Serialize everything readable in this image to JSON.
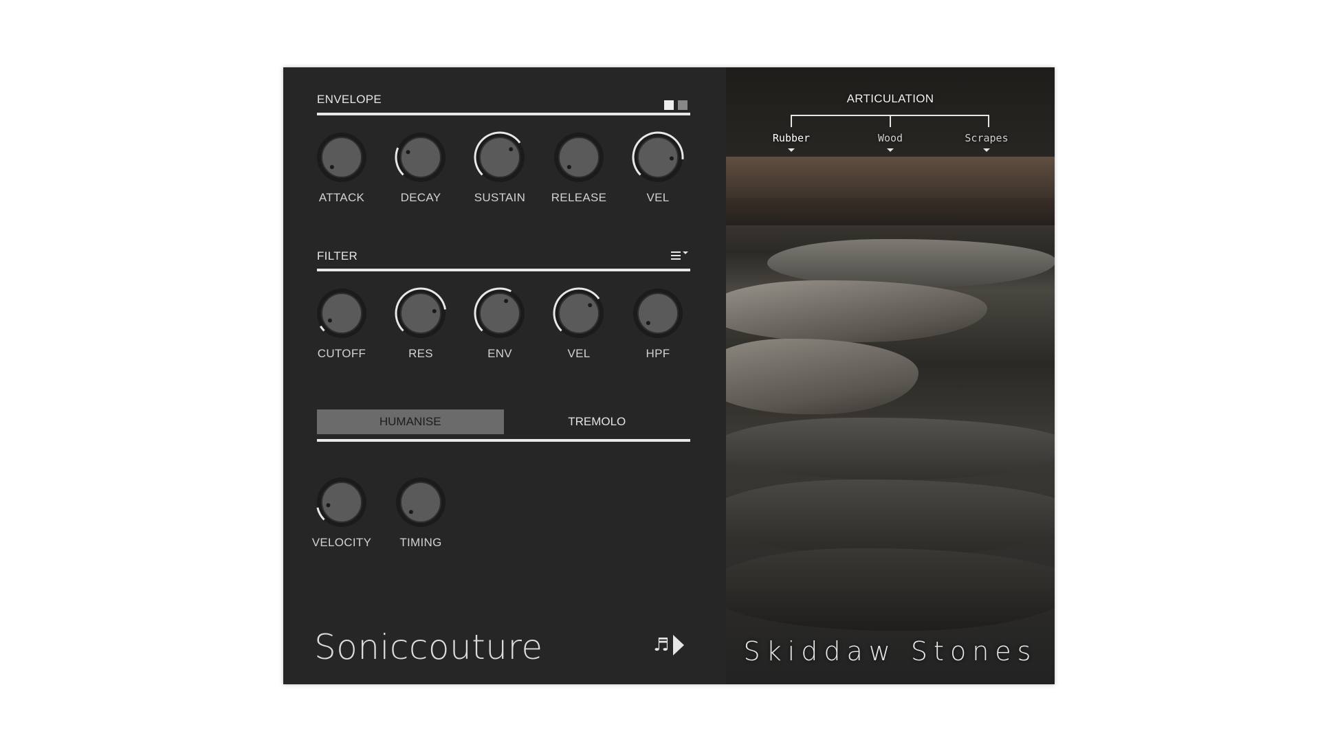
{
  "envelope": {
    "title": "ENVELOPE",
    "knobs": [
      {
        "label": "ATTACK",
        "value": 0.0
      },
      {
        "label": "DECAY",
        "value": 0.25
      },
      {
        "label": "SUSTAIN",
        "value": 0.7
      },
      {
        "label": "RELEASE",
        "value": 0.0
      },
      {
        "label": "VEL",
        "value": 0.85
      }
    ]
  },
  "filter": {
    "title": "FILTER",
    "knobs": [
      {
        "label": "CUTOFF",
        "value": 0.05
      },
      {
        "label": "RES",
        "value": 0.8
      },
      {
        "label": "ENV",
        "value": 0.6
      },
      {
        "label": "VEL",
        "value": 0.7
      },
      {
        "label": "HPF",
        "value": 0.0
      }
    ]
  },
  "tabs": {
    "humanise": "HUMANISE",
    "tremolo": "TREMOLO",
    "active": "humanise"
  },
  "humanise": {
    "knobs": [
      {
        "label": "VELOCITY",
        "value": 0.12
      },
      {
        "label": "TIMING",
        "value": 0.0
      }
    ]
  },
  "brand": "Soniccouture",
  "articulation": {
    "title": "ARTICULATION",
    "options": [
      "Rubber",
      "Wood",
      "Scrapes"
    ],
    "selected": "Rubber"
  },
  "product_name": "Skiddaw Stones",
  "icons": {
    "mode_squares": "mode-toggle-icon",
    "menu": "menu-icon",
    "note": "music-note-icon",
    "play": "play-icon"
  },
  "colors": {
    "panel": "#262626",
    "knob": "#5a5a5a",
    "ring": "#e8e8e8",
    "tab_active": "#6b6b6b"
  }
}
